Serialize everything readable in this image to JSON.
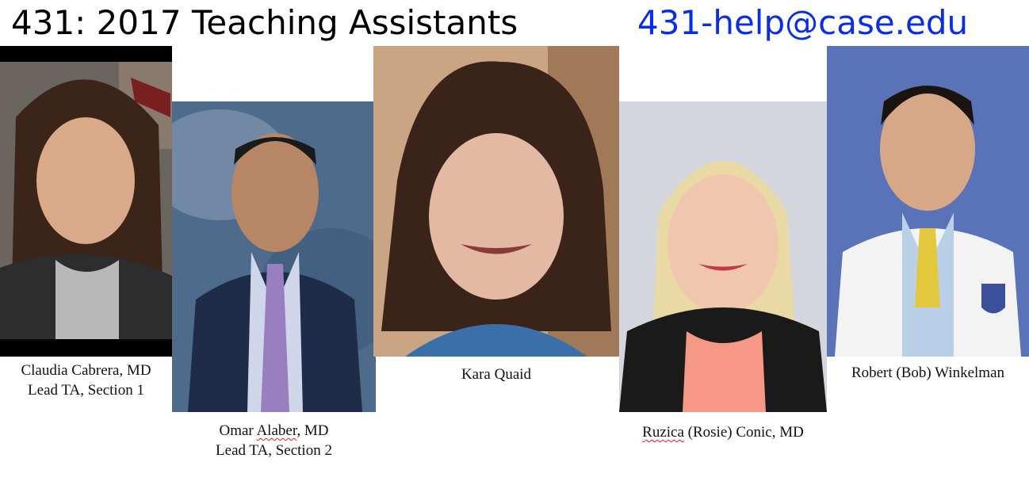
{
  "header": {
    "title": "431: 2017 Teaching Assistants",
    "email": "431-help@case.edu"
  },
  "assistants": [
    {
      "line1": "Claudia Cabrera, MD",
      "line2": "Lead TA, Section 1"
    },
    {
      "line1_pre": "Omar ",
      "line1_flag": "Alaber",
      "line1_post": ", MD",
      "line2": "Lead TA, Section 2"
    },
    {
      "line1": "Kara Quaid"
    },
    {
      "line1_flag": "Ruzica",
      "line1_post": " (Rosie) Conic, MD"
    },
    {
      "line1": "Robert (Bob) Winkelman"
    }
  ]
}
